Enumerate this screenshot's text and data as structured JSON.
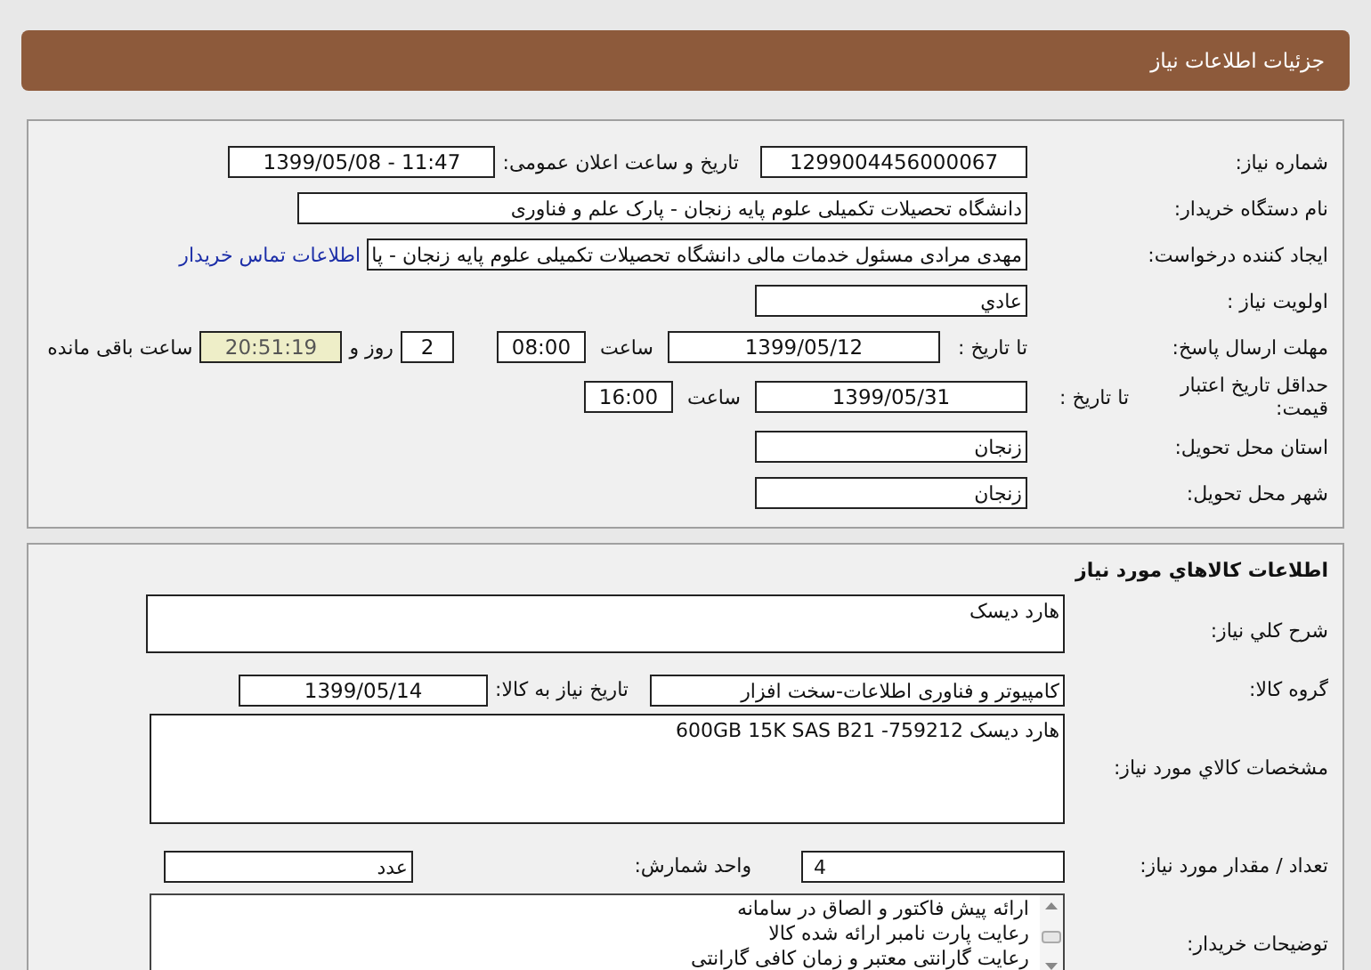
{
  "header": {
    "title": "جزئیات اطلاعات نیاز"
  },
  "general": {
    "need_number": {
      "label": "شماره نیاز:",
      "value": "1299004456000067"
    },
    "announce": {
      "label": "تاریخ و ساعت اعلان عمومی:",
      "value": "1399/05/08 - 11:47"
    },
    "buyer": {
      "label": "نام دستگاه خریدار:",
      "value": "دانشگاه تحصیلات تکمیلی علوم پایه زنجان - پارک علم و فناوری"
    },
    "creator": {
      "label": "ایجاد کننده درخواست:",
      "value": "مهدی مرادی مسئول خدمات مالی دانشگاه تحصیلات تکمیلی علوم پایه زنجان - پا",
      "link": "اطلاعات تماس خریدار"
    },
    "priority": {
      "label": "اولویت نیاز :",
      "value": "عادي"
    },
    "deadline": {
      "label": "مهلت ارسال پاسخ:",
      "date_label": "تا تاریخ :",
      "date": "1399/05/12",
      "time_label": "ساعت",
      "time": "08:00",
      "days": "2",
      "days_label": "روز و",
      "remaining": "20:51:19",
      "remaining_label": "ساعت باقی مانده"
    },
    "validity": {
      "label": "حداقل تاریخ اعتبار قیمت:",
      "date_label": "تا تاریخ :",
      "date": "1399/05/31",
      "time_label": "ساعت",
      "time": "16:00"
    },
    "province": {
      "label": "استان محل تحویل:",
      "value": "زنجان"
    },
    "city": {
      "label": "شهر محل تحویل:",
      "value": "زنجان"
    }
  },
  "goods": {
    "title": "اطلاعات کالاهاي مورد نياز",
    "summary": {
      "label": "شرح کلي نياز:",
      "value": "هارد دیسک"
    },
    "group": {
      "label": "گروه کالا:",
      "value": "کامپیوتر و فناوری اطلاعات-سخت افزار",
      "date_label": "تاریخ نیاز به کالا:",
      "date": "1399/05/14"
    },
    "spec": {
      "label": "مشخصات کالاي مورد نياز:",
      "value": "هارد دیسک 759212- 600GB 15K SAS B21"
    },
    "quantity": {
      "label": "تعداد / مقدار مورد نیاز:",
      "value": "4",
      "unit_label": "واحد شمارش:",
      "unit": "عدد"
    },
    "notes": {
      "label": "توضیحات خریدار:",
      "lines": [
        "ارائه پیش فاکتور و الصاق در سامانه",
        "رعایت پارت نامبر ارائه شده کالا",
        "رعایت گارانتی معتبر و زمان کافی گارانتی"
      ]
    }
  }
}
